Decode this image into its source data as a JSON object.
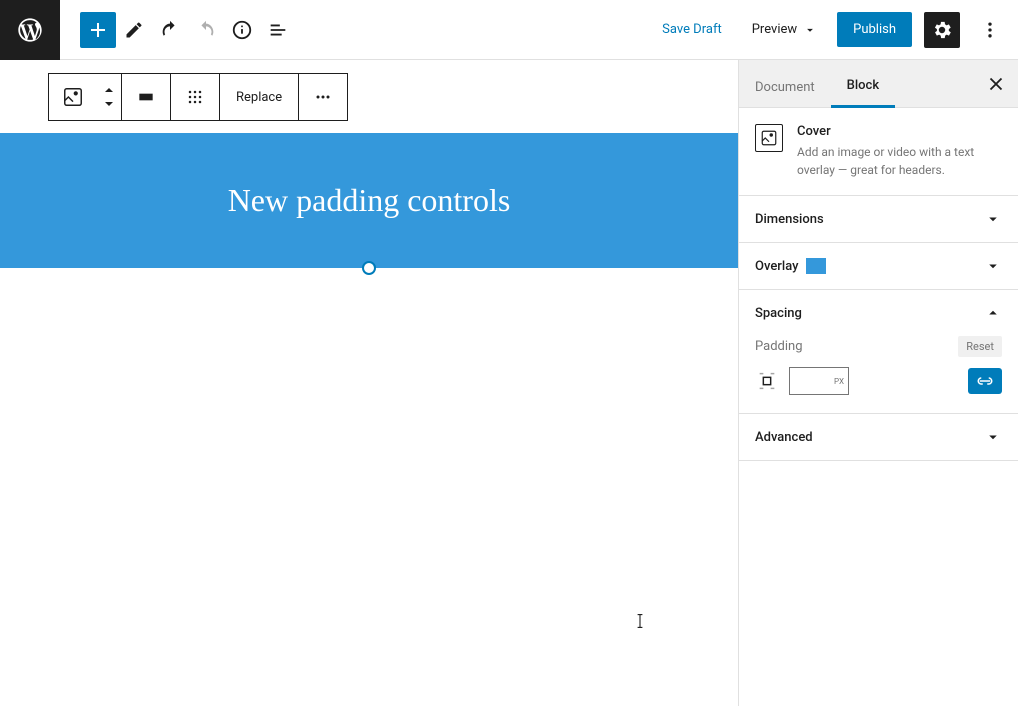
{
  "topbar": {
    "save_draft": "Save Draft",
    "preview": "Preview",
    "publish": "Publish"
  },
  "block_toolbar": {
    "replace": "Replace"
  },
  "cover": {
    "title": "New padding controls"
  },
  "sidebar": {
    "tabs": {
      "document": "Document",
      "block": "Block"
    },
    "block_card": {
      "name": "Cover",
      "description": "Add an image or video with a text overlay — great for headers."
    },
    "panels": {
      "dimensions": "Dimensions",
      "overlay": "Overlay",
      "spacing": "Spacing",
      "advanced": "Advanced"
    },
    "spacing": {
      "padding_label": "Padding",
      "reset": "Reset",
      "unit": "PX",
      "value": ""
    },
    "overlay_color": "#3498db"
  }
}
